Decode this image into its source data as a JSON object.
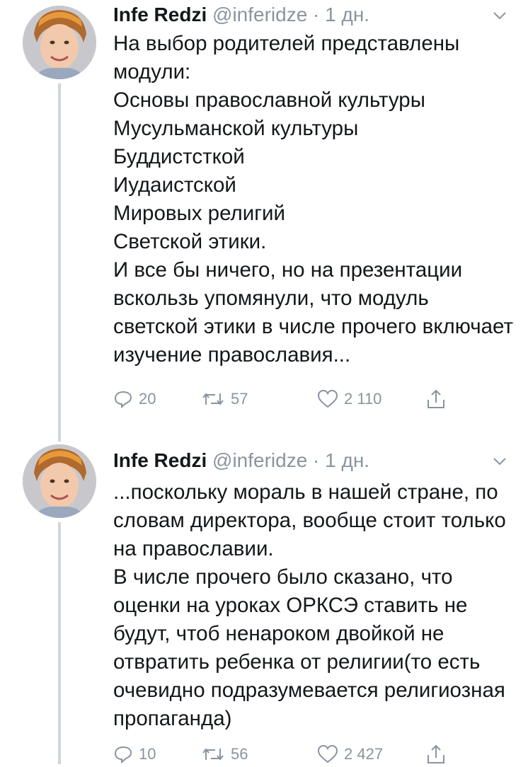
{
  "tweets": [
    {
      "name": "Infe Redzi",
      "meta": "@inferidze · 1 дн.",
      "text": "На выбор родителей представлены модули:\nОсновы православной культуры\nМусульманской культуры\nБуддистсткой\nИудаистской\nМировых религий\nСветской этики.\nИ все бы ничего, но на презентации вскользь упомянули, что модуль светской этики в числе прочего включает изучение православия...",
      "replies": "20",
      "retweets": "57",
      "likes": "2 110"
    },
    {
      "name": "Infe Redzi",
      "meta": "@inferidze · 1 дн.",
      "text": "...поскольку мораль в нашей стране, по словам директора, вообще стоит только на православии.\nВ числе прочего было сказано, что оценки на уроках ОРКСЭ ставить не будут, чтоб ненароком двойкой не отвратить ребенка от религии(то есть очевидно подразумевается религиозная пропаганда)",
      "replies": "10",
      "retweets": "56",
      "likes": "2 427"
    }
  ],
  "icons": {
    "reply": "reply-icon",
    "retweet": "retweet-icon",
    "like": "like-icon",
    "share": "share-icon",
    "caret": "chevron-down-icon"
  },
  "colors": {
    "text": "#14171a",
    "muted": "#8a949e",
    "thread_line": "#cfd6dc"
  }
}
